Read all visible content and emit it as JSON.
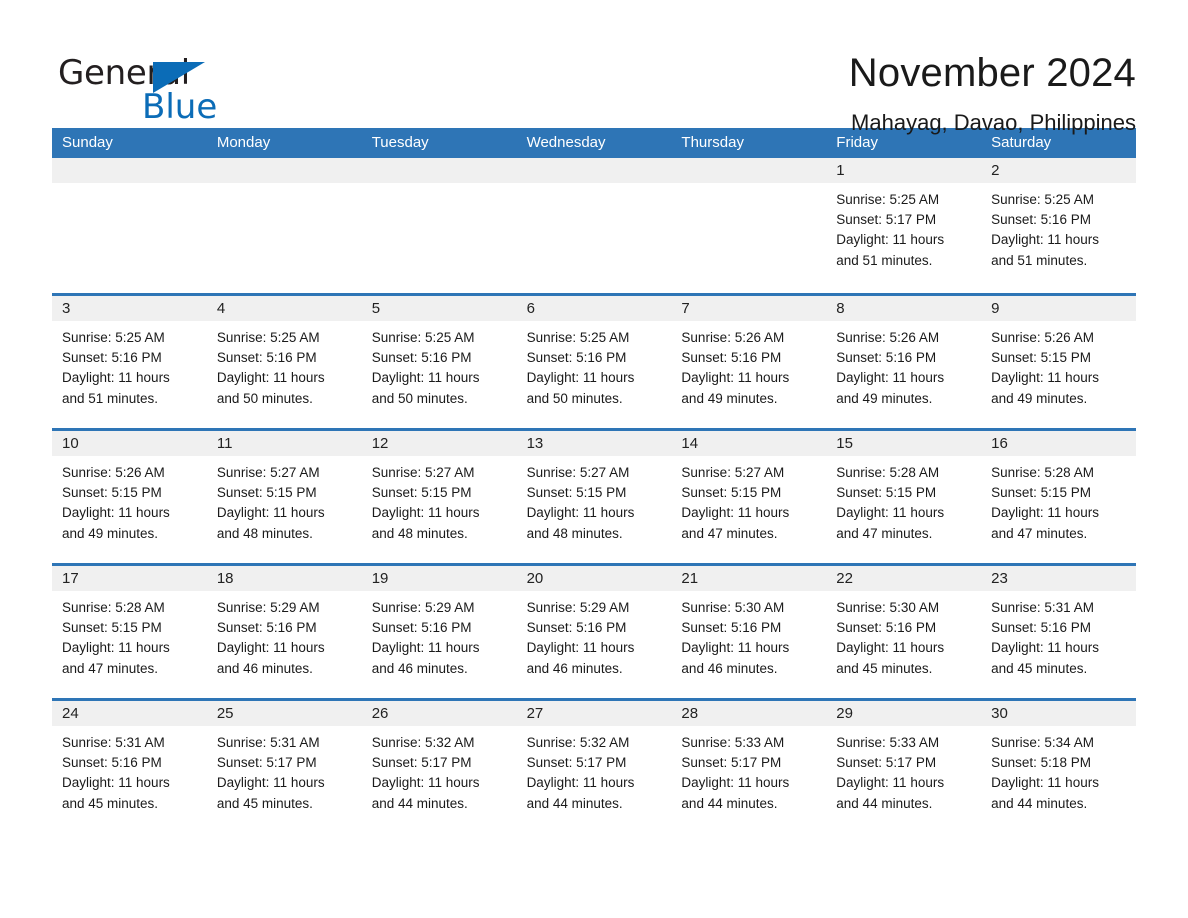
{
  "brand": {
    "name_part1": "General",
    "name_part2": "Blue",
    "triangle_color": "#0b6cb7"
  },
  "header": {
    "month_title": "November 2024",
    "location": "Mahayag, Davao, Philippines"
  },
  "theme": {
    "header_blue": "#2E75B6",
    "row_divider_blue": "#2E75B6",
    "daynum_strip_gray": "#F0F0F0",
    "page_background": "#FFFFFF"
  },
  "weekdays": [
    "Sunday",
    "Monday",
    "Tuesday",
    "Wednesday",
    "Thursday",
    "Friday",
    "Saturday"
  ],
  "weeks": [
    [
      {
        "day": "",
        "sunrise": "",
        "sunset": "",
        "daylight1": "",
        "daylight2": ""
      },
      {
        "day": "",
        "sunrise": "",
        "sunset": "",
        "daylight1": "",
        "daylight2": ""
      },
      {
        "day": "",
        "sunrise": "",
        "sunset": "",
        "daylight1": "",
        "daylight2": ""
      },
      {
        "day": "",
        "sunrise": "",
        "sunset": "",
        "daylight1": "",
        "daylight2": ""
      },
      {
        "day": "",
        "sunrise": "",
        "sunset": "",
        "daylight1": "",
        "daylight2": ""
      },
      {
        "day": "1",
        "sunrise": "Sunrise: 5:25 AM",
        "sunset": "Sunset: 5:17 PM",
        "daylight1": "Daylight: 11 hours",
        "daylight2": "and 51 minutes."
      },
      {
        "day": "2",
        "sunrise": "Sunrise: 5:25 AM",
        "sunset": "Sunset: 5:16 PM",
        "daylight1": "Daylight: 11 hours",
        "daylight2": "and 51 minutes."
      }
    ],
    [
      {
        "day": "3",
        "sunrise": "Sunrise: 5:25 AM",
        "sunset": "Sunset: 5:16 PM",
        "daylight1": "Daylight: 11 hours",
        "daylight2": "and 51 minutes."
      },
      {
        "day": "4",
        "sunrise": "Sunrise: 5:25 AM",
        "sunset": "Sunset: 5:16 PM",
        "daylight1": "Daylight: 11 hours",
        "daylight2": "and 50 minutes."
      },
      {
        "day": "5",
        "sunrise": "Sunrise: 5:25 AM",
        "sunset": "Sunset: 5:16 PM",
        "daylight1": "Daylight: 11 hours",
        "daylight2": "and 50 minutes."
      },
      {
        "day": "6",
        "sunrise": "Sunrise: 5:25 AM",
        "sunset": "Sunset: 5:16 PM",
        "daylight1": "Daylight: 11 hours",
        "daylight2": "and 50 minutes."
      },
      {
        "day": "7",
        "sunrise": "Sunrise: 5:26 AM",
        "sunset": "Sunset: 5:16 PM",
        "daylight1": "Daylight: 11 hours",
        "daylight2": "and 49 minutes."
      },
      {
        "day": "8",
        "sunrise": "Sunrise: 5:26 AM",
        "sunset": "Sunset: 5:16 PM",
        "daylight1": "Daylight: 11 hours",
        "daylight2": "and 49 minutes."
      },
      {
        "day": "9",
        "sunrise": "Sunrise: 5:26 AM",
        "sunset": "Sunset: 5:15 PM",
        "daylight1": "Daylight: 11 hours",
        "daylight2": "and 49 minutes."
      }
    ],
    [
      {
        "day": "10",
        "sunrise": "Sunrise: 5:26 AM",
        "sunset": "Sunset: 5:15 PM",
        "daylight1": "Daylight: 11 hours",
        "daylight2": "and 49 minutes."
      },
      {
        "day": "11",
        "sunrise": "Sunrise: 5:27 AM",
        "sunset": "Sunset: 5:15 PM",
        "daylight1": "Daylight: 11 hours",
        "daylight2": "and 48 minutes."
      },
      {
        "day": "12",
        "sunrise": "Sunrise: 5:27 AM",
        "sunset": "Sunset: 5:15 PM",
        "daylight1": "Daylight: 11 hours",
        "daylight2": "and 48 minutes."
      },
      {
        "day": "13",
        "sunrise": "Sunrise: 5:27 AM",
        "sunset": "Sunset: 5:15 PM",
        "daylight1": "Daylight: 11 hours",
        "daylight2": "and 48 minutes."
      },
      {
        "day": "14",
        "sunrise": "Sunrise: 5:27 AM",
        "sunset": "Sunset: 5:15 PM",
        "daylight1": "Daylight: 11 hours",
        "daylight2": "and 47 minutes."
      },
      {
        "day": "15",
        "sunrise": "Sunrise: 5:28 AM",
        "sunset": "Sunset: 5:15 PM",
        "daylight1": "Daylight: 11 hours",
        "daylight2": "and 47 minutes."
      },
      {
        "day": "16",
        "sunrise": "Sunrise: 5:28 AM",
        "sunset": "Sunset: 5:15 PM",
        "daylight1": "Daylight: 11 hours",
        "daylight2": "and 47 minutes."
      }
    ],
    [
      {
        "day": "17",
        "sunrise": "Sunrise: 5:28 AM",
        "sunset": "Sunset: 5:15 PM",
        "daylight1": "Daylight: 11 hours",
        "daylight2": "and 47 minutes."
      },
      {
        "day": "18",
        "sunrise": "Sunrise: 5:29 AM",
        "sunset": "Sunset: 5:16 PM",
        "daylight1": "Daylight: 11 hours",
        "daylight2": "and 46 minutes."
      },
      {
        "day": "19",
        "sunrise": "Sunrise: 5:29 AM",
        "sunset": "Sunset: 5:16 PM",
        "daylight1": "Daylight: 11 hours",
        "daylight2": "and 46 minutes."
      },
      {
        "day": "20",
        "sunrise": "Sunrise: 5:29 AM",
        "sunset": "Sunset: 5:16 PM",
        "daylight1": "Daylight: 11 hours",
        "daylight2": "and 46 minutes."
      },
      {
        "day": "21",
        "sunrise": "Sunrise: 5:30 AM",
        "sunset": "Sunset: 5:16 PM",
        "daylight1": "Daylight: 11 hours",
        "daylight2": "and 46 minutes."
      },
      {
        "day": "22",
        "sunrise": "Sunrise: 5:30 AM",
        "sunset": "Sunset: 5:16 PM",
        "daylight1": "Daylight: 11 hours",
        "daylight2": "and 45 minutes."
      },
      {
        "day": "23",
        "sunrise": "Sunrise: 5:31 AM",
        "sunset": "Sunset: 5:16 PM",
        "daylight1": "Daylight: 11 hours",
        "daylight2": "and 45 minutes."
      }
    ],
    [
      {
        "day": "24",
        "sunrise": "Sunrise: 5:31 AM",
        "sunset": "Sunset: 5:16 PM",
        "daylight1": "Daylight: 11 hours",
        "daylight2": "and 45 minutes."
      },
      {
        "day": "25",
        "sunrise": "Sunrise: 5:31 AM",
        "sunset": "Sunset: 5:17 PM",
        "daylight1": "Daylight: 11 hours",
        "daylight2": "and 45 minutes."
      },
      {
        "day": "26",
        "sunrise": "Sunrise: 5:32 AM",
        "sunset": "Sunset: 5:17 PM",
        "daylight1": "Daylight: 11 hours",
        "daylight2": "and 44 minutes."
      },
      {
        "day": "27",
        "sunrise": "Sunrise: 5:32 AM",
        "sunset": "Sunset: 5:17 PM",
        "daylight1": "Daylight: 11 hours",
        "daylight2": "and 44 minutes."
      },
      {
        "day": "28",
        "sunrise": "Sunrise: 5:33 AM",
        "sunset": "Sunset: 5:17 PM",
        "daylight1": "Daylight: 11 hours",
        "daylight2": "and 44 minutes."
      },
      {
        "day": "29",
        "sunrise": "Sunrise: 5:33 AM",
        "sunset": "Sunset: 5:17 PM",
        "daylight1": "Daylight: 11 hours",
        "daylight2": "and 44 minutes."
      },
      {
        "day": "30",
        "sunrise": "Sunrise: 5:34 AM",
        "sunset": "Sunset: 5:18 PM",
        "daylight1": "Daylight: 11 hours",
        "daylight2": "and 44 minutes."
      }
    ]
  ]
}
